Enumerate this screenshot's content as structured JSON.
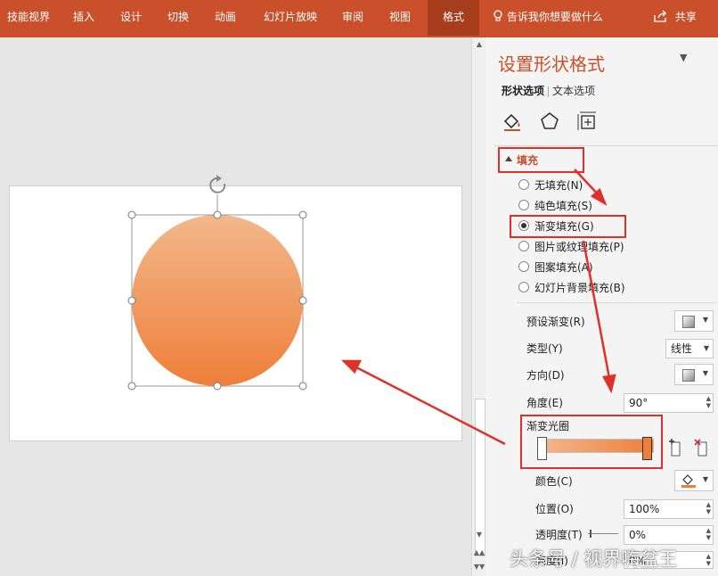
{
  "ribbon": {
    "tabs": [
      {
        "label": "技能视界"
      },
      {
        "label": "插入"
      },
      {
        "label": "设计"
      },
      {
        "label": "切换"
      },
      {
        "label": "动画"
      },
      {
        "label": "幻灯片放映"
      },
      {
        "label": "审阅"
      },
      {
        "label": "视图"
      },
      {
        "label": "格式"
      }
    ],
    "active_tab": "格式",
    "tell_me": "告诉我你想要做什么",
    "share": "共享",
    "color": "#c9502a"
  },
  "shape": {
    "gradient_top": "#f3b88b",
    "gradient_bottom": "#ee7f3a"
  },
  "pane": {
    "title": "设置形状格式",
    "subtabs": {
      "shape_options": "形状选项",
      "text_options": "文本选项"
    },
    "fill": {
      "header": "填充",
      "options": [
        {
          "label": "无填充(N)",
          "selected": false
        },
        {
          "label": "纯色填充(S)",
          "selected": false
        },
        {
          "label": "渐变填充(G)",
          "selected": true
        },
        {
          "label": "图片或纹理填充(P)",
          "selected": false
        },
        {
          "label": "图案填充(A)",
          "selected": false
        },
        {
          "label": "幻灯片背景填充(B)",
          "selected": false
        }
      ]
    },
    "gradient": {
      "preset_label": "预设渐变(R)",
      "type_label": "类型(Y)",
      "type_value": "线性",
      "direction_label": "方向(D)",
      "angle_label": "角度(E)",
      "angle_value": "90°",
      "stops_label": "渐变光圈",
      "color_label": "颜色(C)",
      "position_label": "位置(O)",
      "position_value": "100%",
      "transparency_label": "透明度(T)",
      "transparency_value": "0%",
      "brightness_label": "亮度(I)",
      "brightness_value": "0%",
      "stop_colors": [
        "#f3b88b",
        "#ee7f3a"
      ]
    }
  },
  "watermark": "头条号 / 视界嗨盆王",
  "annotation_color": "#e0302a"
}
